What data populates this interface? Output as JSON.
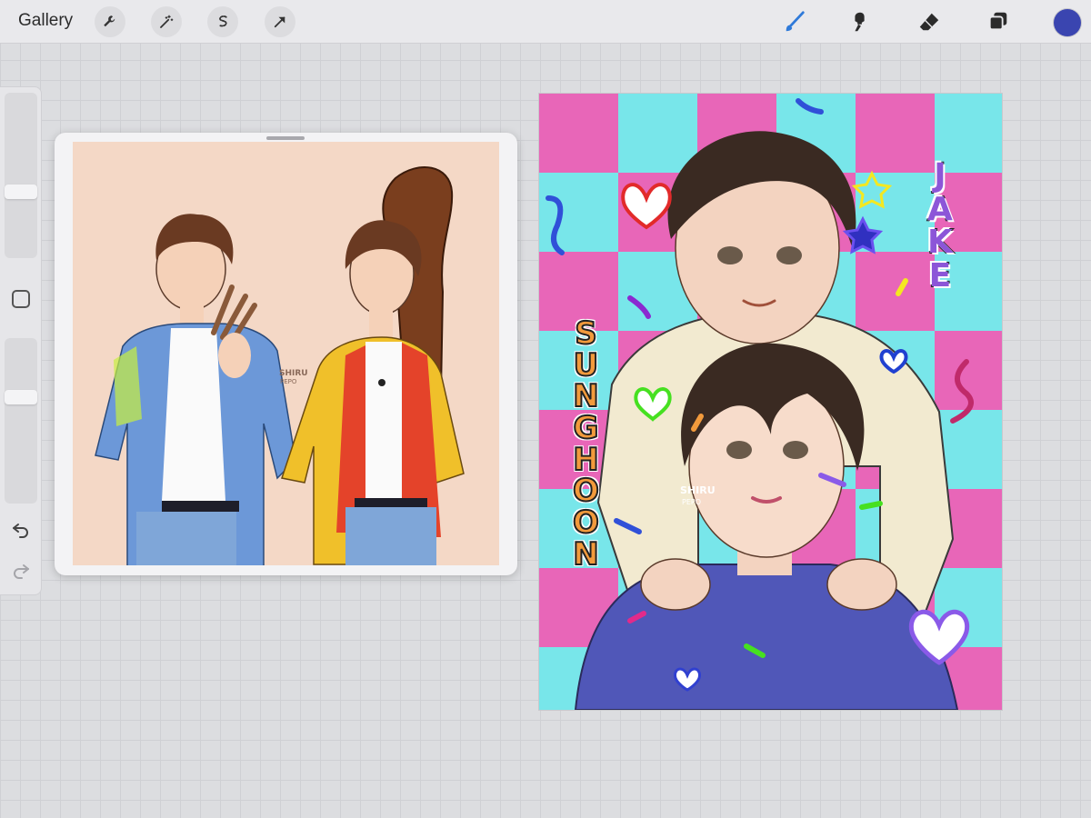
{
  "toolbar": {
    "gallery_label": "Gallery",
    "left_tools": [
      {
        "icon": "wrench-icon"
      },
      {
        "icon": "magic-wand-icon"
      },
      {
        "icon": "selection-s-icon"
      },
      {
        "icon": "arrow-transform-icon"
      }
    ],
    "right_tools": [
      {
        "icon": "brush-icon",
        "active": true
      },
      {
        "icon": "smudge-icon"
      },
      {
        "icon": "eraser-icon"
      },
      {
        "icon": "layers-icon"
      }
    ],
    "current_color": "#3a45b0",
    "active_color": "#2f7ad9"
  },
  "sidebar": {
    "controls": [
      "brush-size-slider",
      "modify-button",
      "opacity-slider",
      "undo-icon",
      "redo-icon"
    ]
  },
  "canvas": {
    "name_top": [
      "J",
      "A",
      "K",
      "E"
    ],
    "name_bottom": [
      "S",
      "U",
      "N",
      "G",
      "H",
      "O",
      "O",
      "N"
    ],
    "watermark": "SHIRU PEPO"
  },
  "reference": {
    "watermark": "SHIRU PEPO"
  },
  "colors": {
    "pink": "#e866b8",
    "cyan": "#78e6ea",
    "jake_letters": "#8c56d8",
    "sunghoon_letters": "#f29a3c",
    "shirt_blue": "#5057b8",
    "sweater_cream": "#f2ead0"
  }
}
